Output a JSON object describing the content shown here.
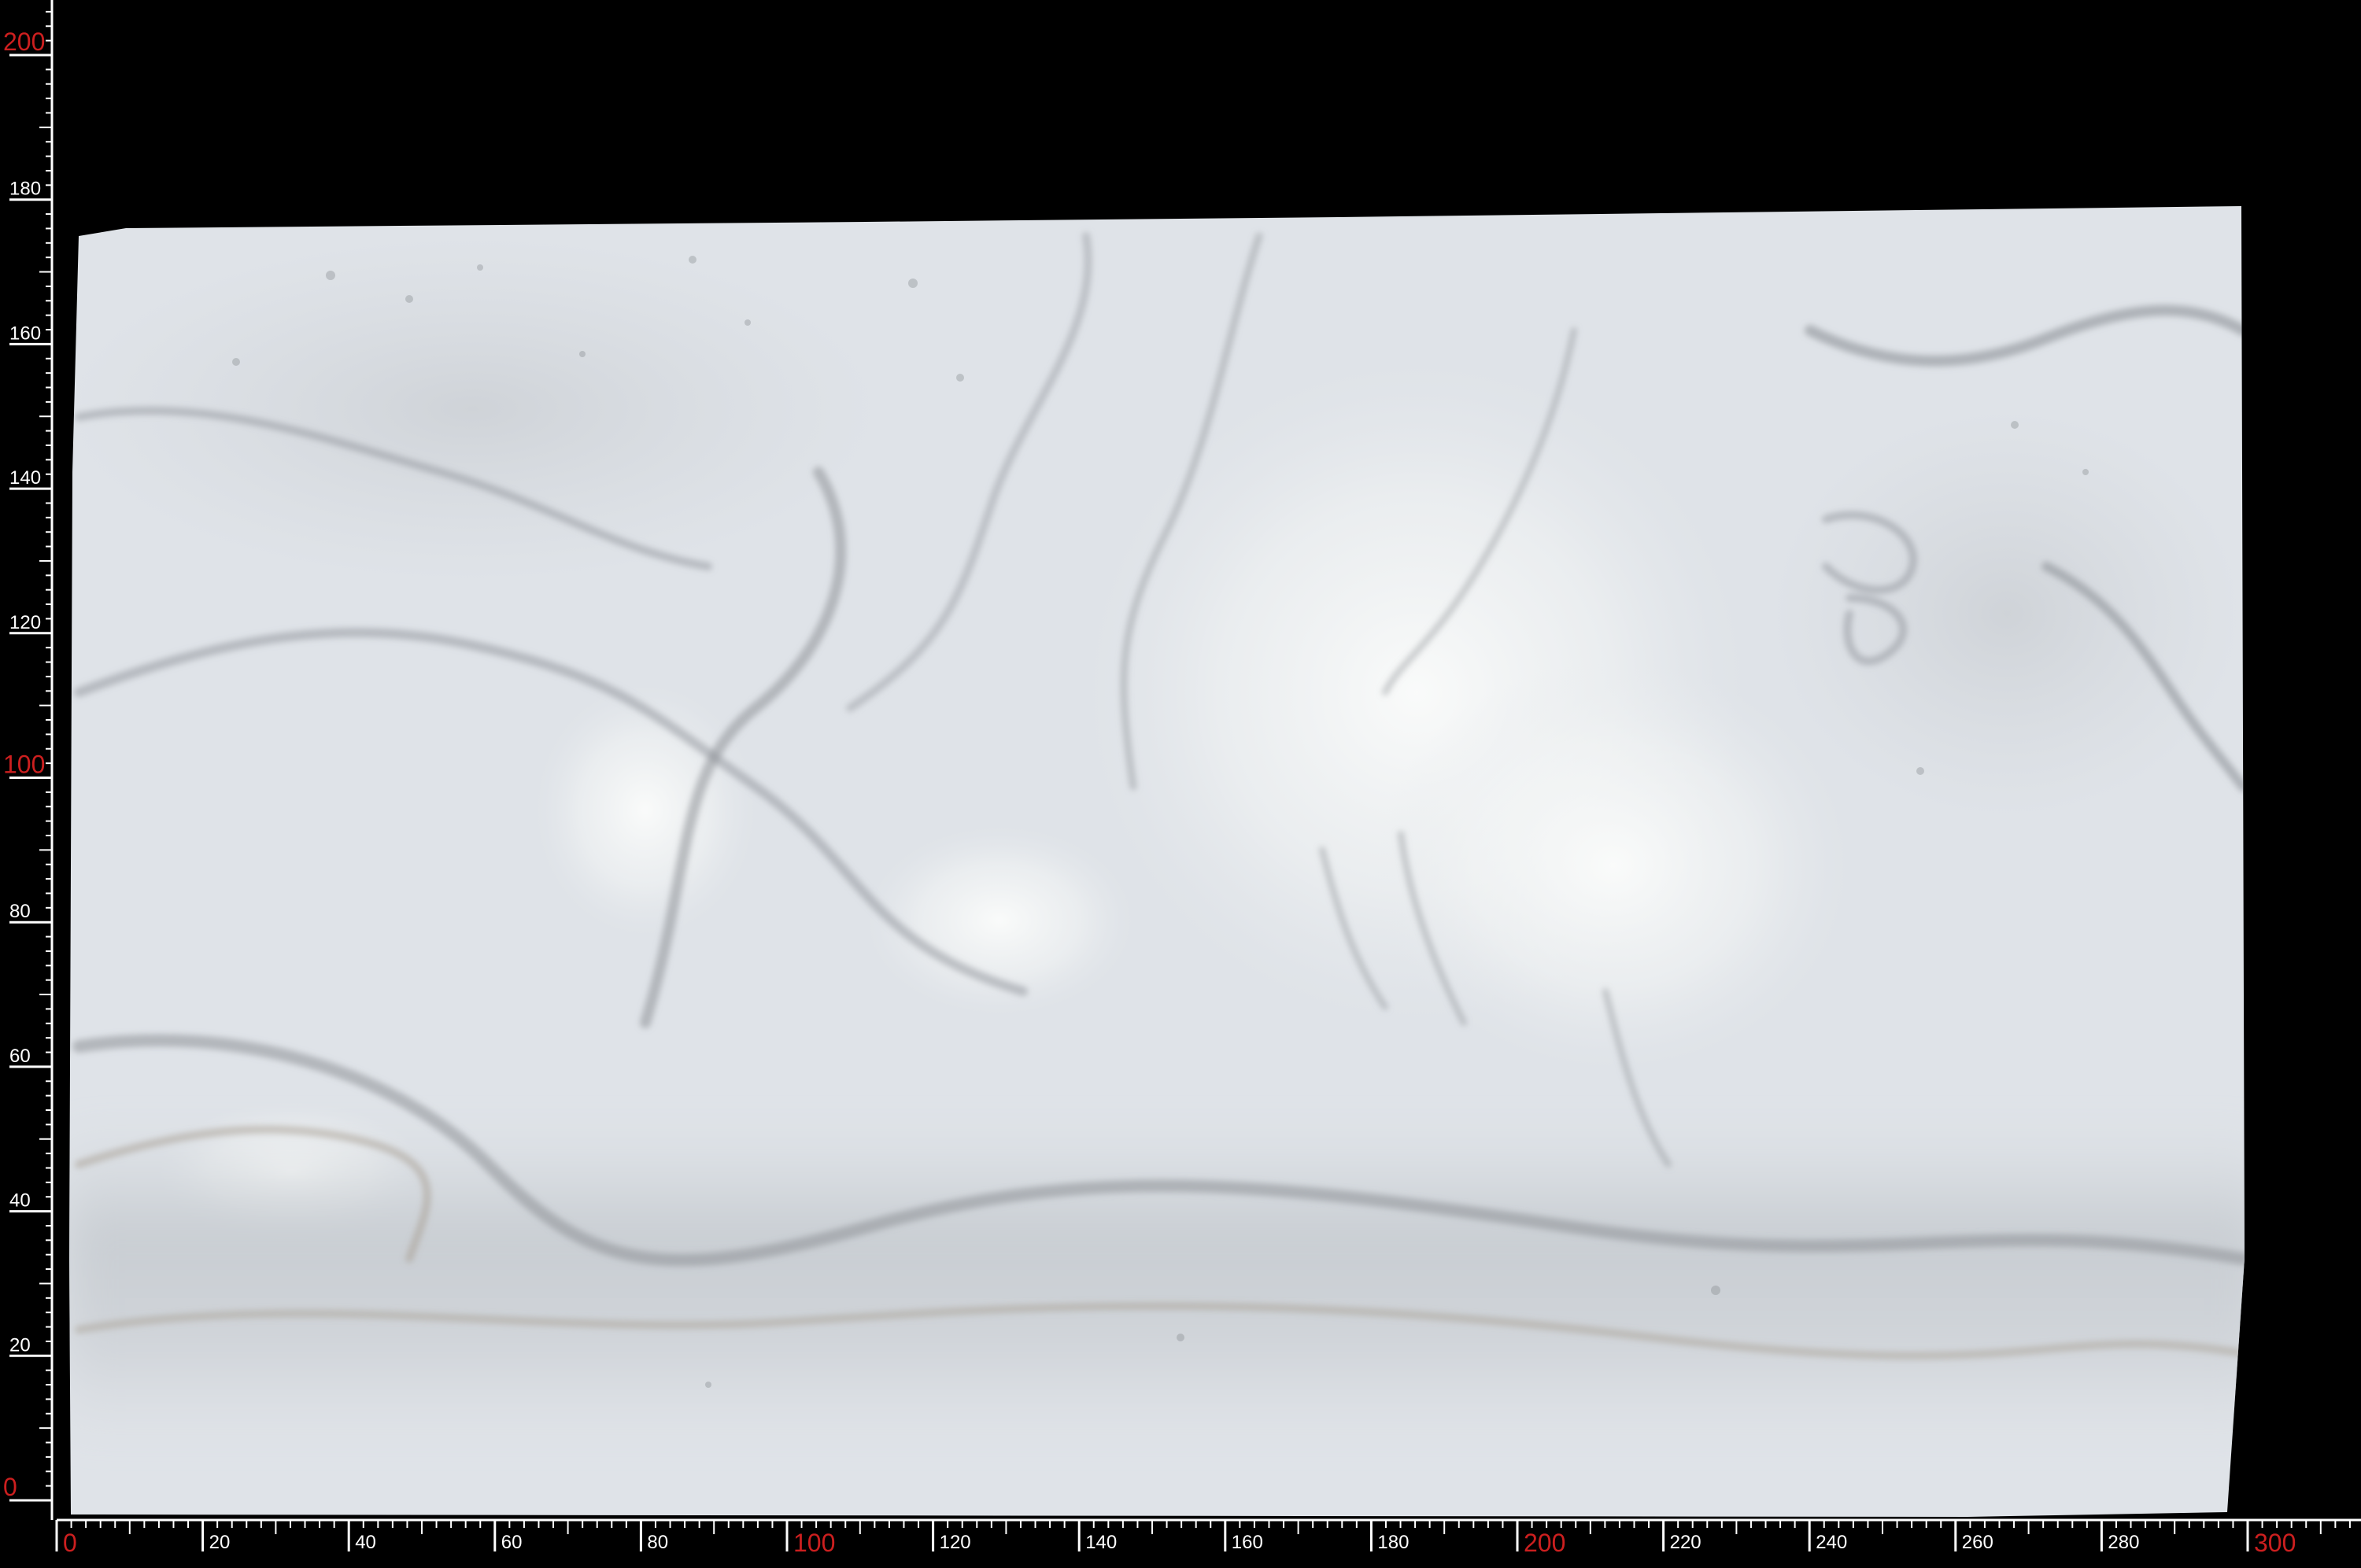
{
  "scene": {
    "subject": "marble-slab",
    "background_color": "#000000",
    "slab_base_color": "#dfe3e8",
    "vein_color_gray": "#8e9297",
    "vein_color_warm": "#a59c8f",
    "highlight_color": "#f6f8f8"
  },
  "ruler": {
    "color": "#ffffff",
    "major_label_color": "#cc1f1f",
    "x_axis": {
      "min": 0,
      "max": 300,
      "labels": [
        {
          "value": 0,
          "text": "0",
          "major": true
        },
        {
          "value": 20,
          "text": "20",
          "major": false
        },
        {
          "value": 40,
          "text": "40",
          "major": false
        },
        {
          "value": 60,
          "text": "60",
          "major": false
        },
        {
          "value": 80,
          "text": "80",
          "major": false
        },
        {
          "value": 100,
          "text": "100",
          "major": true
        },
        {
          "value": 120,
          "text": "120",
          "major": false
        },
        {
          "value": 140,
          "text": "140",
          "major": false
        },
        {
          "value": 160,
          "text": "160",
          "major": false
        },
        {
          "value": 180,
          "text": "180",
          "major": false
        },
        {
          "value": 200,
          "text": "200",
          "major": true
        },
        {
          "value": 220,
          "text": "220",
          "major": false
        },
        {
          "value": 240,
          "text": "240",
          "major": false
        },
        {
          "value": 260,
          "text": "260",
          "major": false
        },
        {
          "value": 280,
          "text": "280",
          "major": false
        },
        {
          "value": 300,
          "text": "300",
          "major": true
        }
      ]
    },
    "y_axis": {
      "min": 0,
      "max": 200,
      "labels": [
        {
          "value": 0,
          "text": "0",
          "major": true
        },
        {
          "value": 20,
          "text": "20",
          "major": false
        },
        {
          "value": 40,
          "text": "40",
          "major": false
        },
        {
          "value": 60,
          "text": "60",
          "major": false
        },
        {
          "value": 80,
          "text": "80",
          "major": false
        },
        {
          "value": 100,
          "text": "100",
          "major": true
        },
        {
          "value": 120,
          "text": "120",
          "major": false
        },
        {
          "value": 140,
          "text": "140",
          "major": false
        },
        {
          "value": 160,
          "text": "160",
          "major": false
        },
        {
          "value": 180,
          "text": "180",
          "major": false
        },
        {
          "value": 200,
          "text": "200",
          "major": true
        }
      ]
    }
  }
}
